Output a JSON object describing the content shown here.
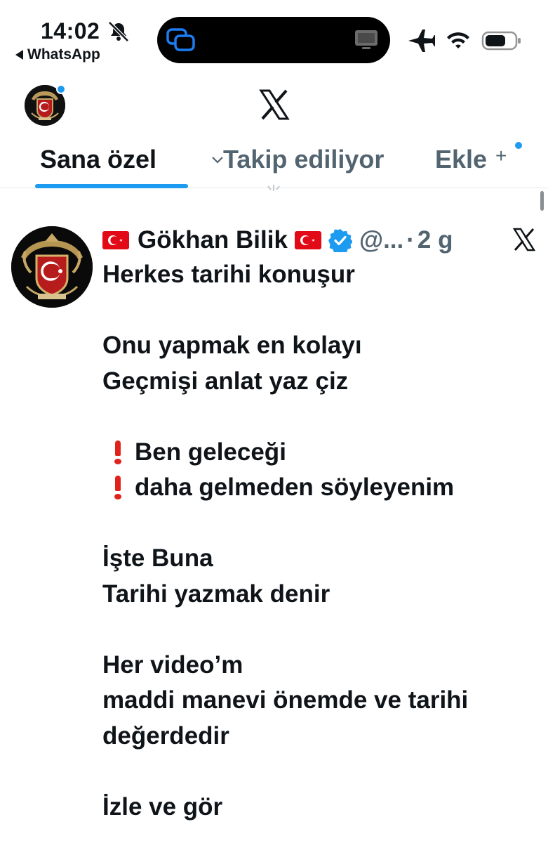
{
  "status_bar": {
    "time": "14:02",
    "back_app": "WhatsApp",
    "icons": [
      "bell-muted-icon",
      "screen-mirroring-icon",
      "airplane-icon",
      "wifi-icon",
      "battery-icon"
    ]
  },
  "header": {
    "logo": "x-logo",
    "avatar_notification": true
  },
  "tabs": [
    {
      "label": "Sana özel",
      "active": true
    },
    {
      "label": "Takip ediliyor",
      "active": false
    },
    {
      "label": "Ekle",
      "active": false
    }
  ],
  "tabs_plus": "+",
  "post": {
    "author": "Gökhan Bilik",
    "handle": "@...",
    "separator": "·",
    "age": "2 g",
    "verified": true,
    "lines": [
      "Herkes tarihi konuşur",
      "",
      "Onu yapmak en kolayı",
      "Geçmişi anlat yaz çiz",
      "",
      "Ben geleceği",
      "daha gelmeden söyleyenim",
      "",
      "İşte Buna",
      "Tarihi yazmak denir",
      "",
      "Her video’m",
      "maddi manevi önemde ve tarihi",
      "değerdedir",
      "",
      "İzle ve gör"
    ]
  },
  "colors": {
    "accent": "#1d9bf0",
    "text": "#0f1419",
    "muted": "#536471",
    "flag_red": "#e30a17",
    "exclamation": "#e0231a"
  }
}
